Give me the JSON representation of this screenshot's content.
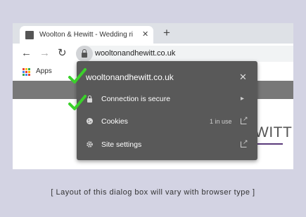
{
  "tab": {
    "title": "Woolton & Hewitt - Wedding ri",
    "close": "✕",
    "new_tab": "+"
  },
  "toolbar": {
    "back": "←",
    "forward": "→",
    "reload": "↻",
    "url": "wooltonandhewitt.co.uk"
  },
  "bookmarks": {
    "apps_label": "Apps",
    "apps_colors": [
      "#ea4335",
      "#fbbc05",
      "#34a853",
      "#4285f4",
      "#ea4335",
      "#fbbc05",
      "#34a853",
      "#4285f4",
      "#ea4335"
    ]
  },
  "page": {
    "partial_text": "WITT"
  },
  "popup": {
    "title": "wooltonandhewitt.co.uk",
    "close": "✕",
    "rows": [
      {
        "label": "Connection is secure",
        "detail": "",
        "trail": "▸",
        "icon": "lock-icon"
      },
      {
        "label": "Cookies",
        "detail": "1 in use",
        "trail": "",
        "icon": "cookie-icon"
      },
      {
        "label": "Site settings",
        "detail": "",
        "trail": "",
        "icon": "gear-icon"
      }
    ]
  },
  "colors": {
    "checkmark": "#3bd12b",
    "popup_bg": "#595959",
    "background": "#d3d3e3"
  },
  "caption": "[ Layout of this dialog box will vary with browser type ]"
}
